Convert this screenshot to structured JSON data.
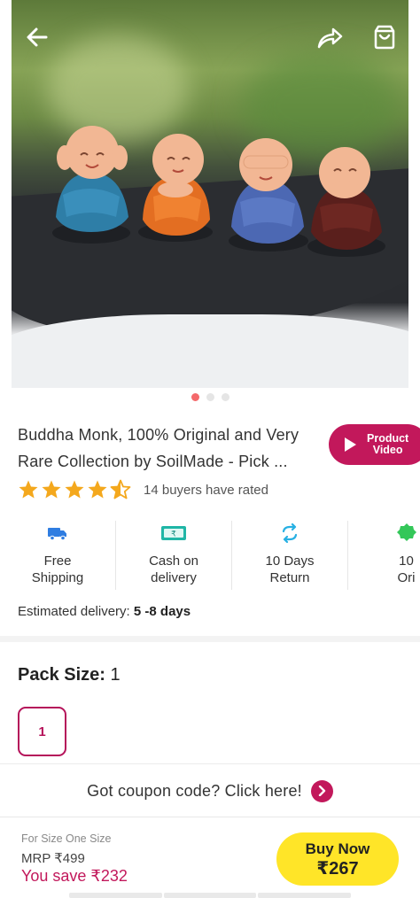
{
  "header": {
    "back_icon": "arrow-left-icon",
    "share_icon": "share-icon",
    "cart_icon": "shopping-bag-icon"
  },
  "gallery": {
    "slide_count": 3,
    "active_slide": 1,
    "active_dot_color": "#f4696b"
  },
  "product": {
    "title_line1": "Buddha Monk, 100% Original and Very",
    "title_line2": "Rare Collection by SoilMade - Pick ...",
    "video_button_line1": "Product",
    "video_button_line2": "Video",
    "rating_value": 4.5,
    "rating_max": 5,
    "rating_text": "14 buyers have rated"
  },
  "features": [
    {
      "icon": "truck-icon",
      "line1": "Free",
      "line2": "Shipping",
      "color": "#2f7de1"
    },
    {
      "icon": "cash-icon",
      "line1": "Cash on",
      "line2": "delivery",
      "color": "#1fb6a6"
    },
    {
      "icon": "return-arrows-icon",
      "line1": "10 Days",
      "line2": "Return",
      "color": "#27b0e3"
    },
    {
      "icon": "original-badge-icon",
      "line1": "10",
      "line2": "Ori",
      "color": "#34c759"
    }
  ],
  "delivery": {
    "label": "Estimated delivery:",
    "value": "5 -8 days"
  },
  "pack": {
    "label": "Pack Size:",
    "value": "1",
    "options": [
      "1"
    ]
  },
  "coupon": {
    "text": "Got coupon code? Click here!"
  },
  "bottom_bar": {
    "size_note": "For Size One Size",
    "mrp": "MRP ₹499",
    "you_save": "You save ₹232",
    "buy_label": "Buy Now",
    "buy_price": "₹267"
  },
  "colors": {
    "brand": "#c2185b",
    "buy_button": "#ffe528",
    "star": "#f4a81d"
  }
}
